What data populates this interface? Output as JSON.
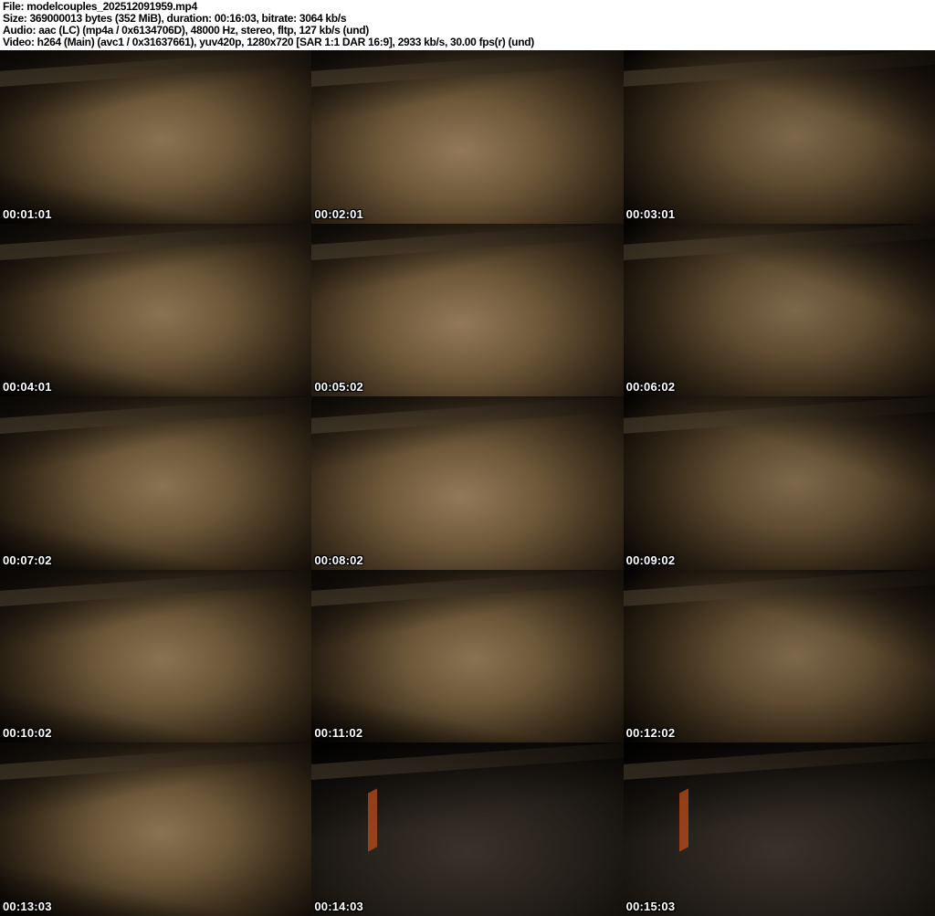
{
  "header": {
    "file": "File: modelcouples_202512091959.mp4",
    "size": "Size: 369000013 bytes (352 MiB), duration: 00:16:03, bitrate: 3064 kb/s",
    "audio": "Audio: aac (LC) (mp4a / 0x6134706D), 48000 Hz, stereo, fltp, 127 kb/s (und)",
    "video": "Video: h264 (Main) (avc1 / 0x31637661), yuv420p, 1280x720 [SAR 1:1 DAR 16:9], 2933 kb/s, 30.00 fps(r) (und)"
  },
  "grid": {
    "columns": 3,
    "rows": 5,
    "thumbnails": [
      {
        "timestamp": "00:01:01"
      },
      {
        "timestamp": "00:02:01"
      },
      {
        "timestamp": "00:03:01"
      },
      {
        "timestamp": "00:04:01"
      },
      {
        "timestamp": "00:05:02"
      },
      {
        "timestamp": "00:06:02"
      },
      {
        "timestamp": "00:07:02"
      },
      {
        "timestamp": "00:08:02"
      },
      {
        "timestamp": "00:09:02"
      },
      {
        "timestamp": "00:10:02"
      },
      {
        "timestamp": "00:11:02"
      },
      {
        "timestamp": "00:12:02"
      },
      {
        "timestamp": "00:13:03"
      },
      {
        "timestamp": "00:14:03"
      },
      {
        "timestamp": "00:15:03"
      }
    ]
  },
  "colors": {
    "header_bg": "#ffffff",
    "header_text": "#000000",
    "page_bg": "#000000",
    "timestamp_text": "#ffffff",
    "wall_accent": "#b24a1c"
  }
}
